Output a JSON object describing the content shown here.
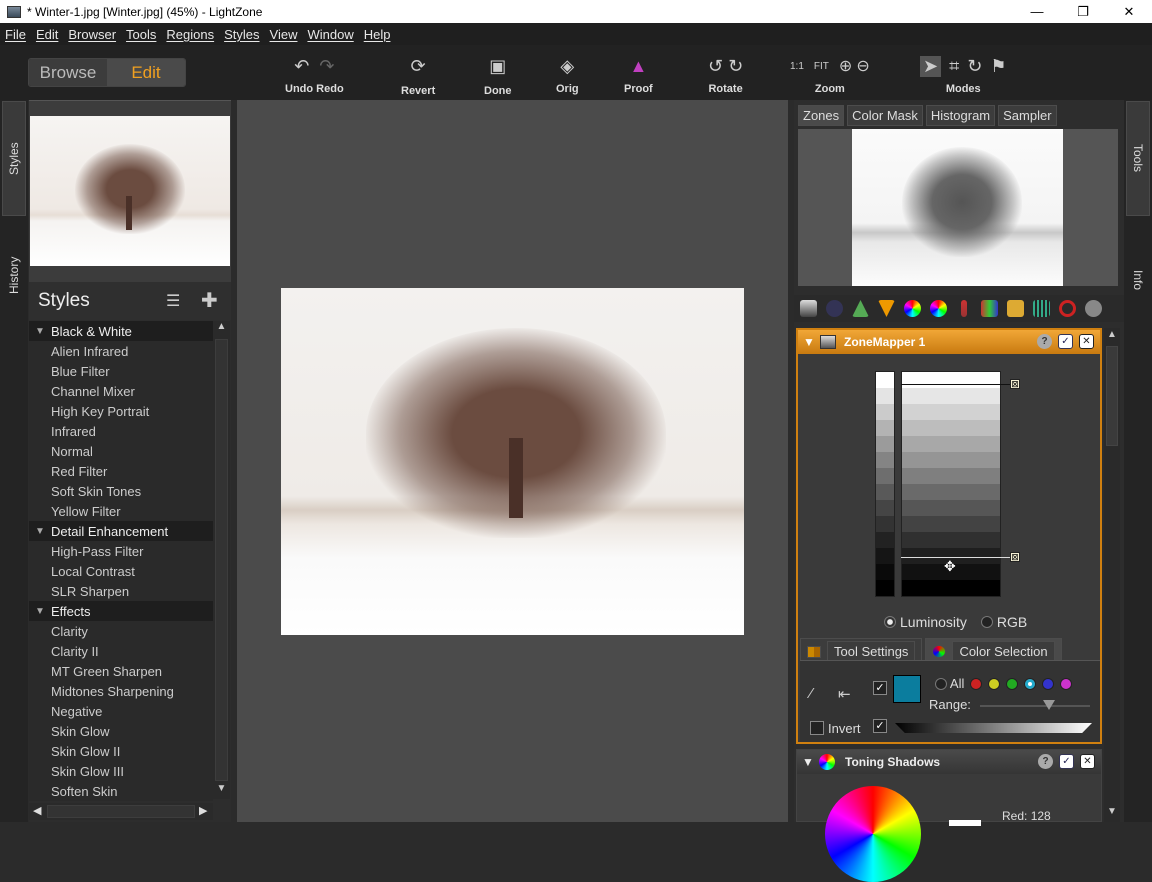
{
  "window": {
    "title": "* Winter-1.jpg [Winter.jpg] (45%) - LightZone",
    "minimize": "—",
    "maximize": "❐",
    "close": "✕"
  },
  "menu": [
    "File",
    "Edit",
    "Browser",
    "Tools",
    "Regions",
    "Styles",
    "View",
    "Window",
    "Help"
  ],
  "mode": {
    "browse": "Browse",
    "edit": "Edit"
  },
  "toolbar": {
    "undo_redo": "Undo Redo",
    "revert": "Revert",
    "done": "Done",
    "orig": "Orig",
    "proof": "Proof",
    "rotate": "Rotate",
    "zoom": "Zoom",
    "zoom_1to1": "1:1",
    "zoom_fit": "FIT",
    "modes": "Modes"
  },
  "left_tabs": {
    "styles": "Styles",
    "history": "History"
  },
  "right_tabs": {
    "tools": "Tools",
    "info": "Info"
  },
  "styles_panel": {
    "title": "Styles",
    "categories": [
      {
        "name": "Black & White",
        "items": [
          "Alien Infrared",
          "Blue Filter",
          "Channel Mixer",
          "High Key Portrait",
          "Infrared",
          "Normal",
          "Red Filter",
          "Soft Skin Tones",
          "Yellow Filter"
        ]
      },
      {
        "name": "Detail Enhancement",
        "items": [
          "High-Pass Filter",
          "Local Contrast",
          "SLR Sharpen"
        ]
      },
      {
        "name": "Effects",
        "items": [
          "Clarity",
          "Clarity II",
          "MT Green Sharpen",
          "Midtones Sharpening",
          "Negative",
          "Skin Glow",
          "Skin Glow II",
          "Skin Glow III",
          "Soften Skin"
        ]
      }
    ]
  },
  "right_panel": {
    "tabs": [
      "Zones",
      "Color Mask",
      "Histogram",
      "Sampler"
    ],
    "zonemapper": {
      "title": "ZoneMapper 1",
      "luminosity": "Luminosity",
      "rgb": "RGB",
      "tab_tool_settings": "Tool Settings",
      "tab_color_selection": "Color Selection",
      "all": "All",
      "range": "Range:",
      "invert": "Invert",
      "selected_color": "#0b7d9e"
    },
    "toning": {
      "title": "Toning Shadows",
      "red_label": "Red:",
      "red_value": "128"
    }
  },
  "colors": {
    "accent": "#f0a020",
    "panel_border": "#d08010"
  }
}
